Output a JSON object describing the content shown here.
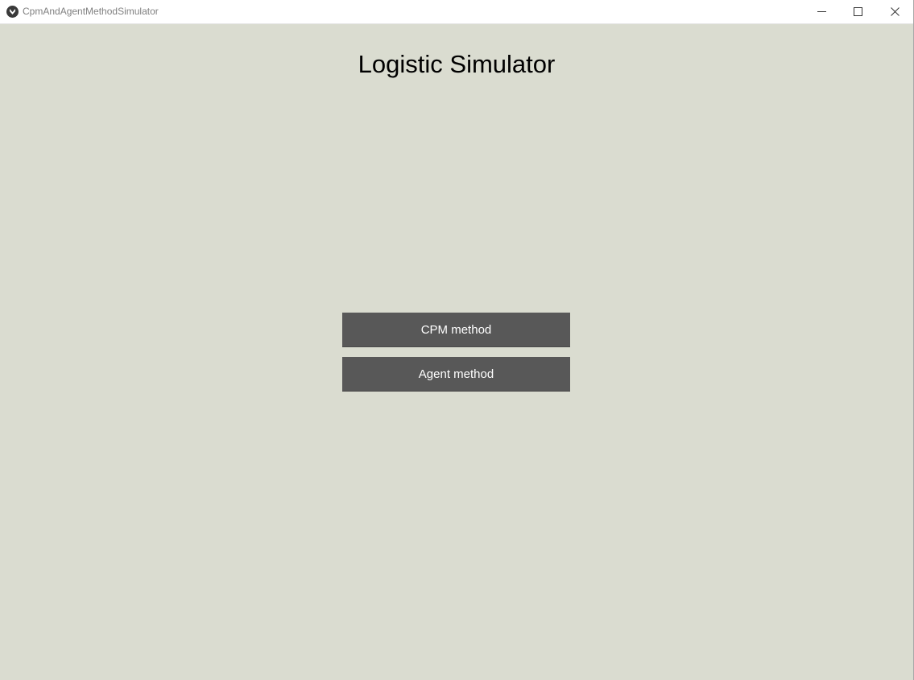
{
  "window": {
    "title": "CpmAndAgentMethodSimulator",
    "app_icon": "kivy-app-icon",
    "controls": [
      "minimize-icon",
      "maximize-icon",
      "close-icon"
    ]
  },
  "main": {
    "title": "Logistic Simulator",
    "buttons": [
      {
        "label": "CPM method"
      },
      {
        "label": "Agent method"
      }
    ]
  },
  "colors": {
    "background": "#dadcd0",
    "button": "#585858",
    "button_text": "#ffffff",
    "title_text": "#000000"
  }
}
